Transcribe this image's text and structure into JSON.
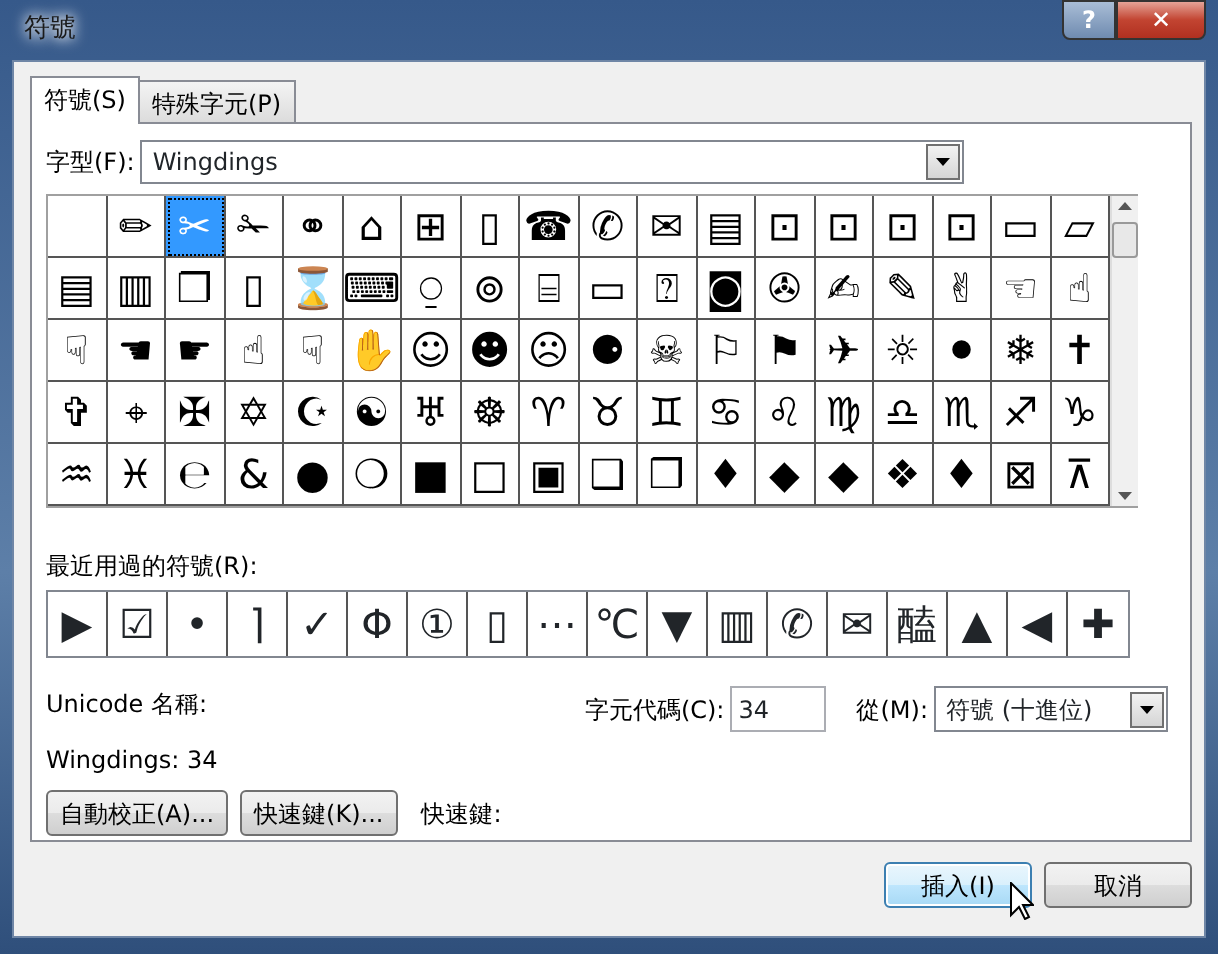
{
  "window": {
    "title": "符號",
    "help_button": "?",
    "close_button": "✕"
  },
  "tabs": [
    {
      "label": "符號(S)",
      "selected": true
    },
    {
      "label": "特殊字元(P)",
      "selected": false
    }
  ],
  "font": {
    "label": "字型(F):",
    "value": "Wingdings"
  },
  "grid": {
    "rows": [
      [
        {
          "selected": false
        },
        {
          "char": "✏",
          "selected": false
        },
        {
          "char": "✂",
          "selected": true
        },
        {
          "char": "✁",
          "selected": false
        },
        {
          "char": "⚭",
          "selected": false
        },
        {
          "char": "⌂",
          "selected": false
        },
        {
          "char": "⊞",
          "selected": false
        },
        {
          "char": "▯",
          "selected": false
        },
        {
          "char": "☎",
          "selected": false
        },
        {
          "char": "✆",
          "selected": false
        },
        {
          "char": "✉",
          "selected": false
        },
        {
          "char": "▤",
          "selected": false
        },
        {
          "char": "⊡",
          "selected": false
        },
        {
          "char": "⊡",
          "selected": false
        },
        {
          "char": "⊡",
          "selected": false
        },
        {
          "char": "⊡",
          "selected": false
        },
        {
          "char": "▭",
          "selected": false
        },
        {
          "char": "▱",
          "selected": false
        }
      ],
      [
        {
          "char": "▤",
          "selected": false
        },
        {
          "char": "▥",
          "selected": false
        },
        {
          "char": "❐",
          "selected": false
        },
        {
          "char": "▯",
          "selected": false
        },
        {
          "char": "⌛",
          "selected": false
        },
        {
          "char": "⌨",
          "selected": false
        },
        {
          "char": "⍜",
          "selected": false
        },
        {
          "char": "⊚",
          "selected": false
        },
        {
          "char": "⌸",
          "selected": false
        },
        {
          "char": "▭",
          "selected": false
        },
        {
          "char": "⍰",
          "selected": false
        },
        {
          "char": "◙",
          "selected": false
        },
        {
          "char": "✇",
          "selected": false
        },
        {
          "char": "✍",
          "selected": false
        },
        {
          "char": "✎",
          "selected": false
        },
        {
          "char": "✌",
          "selected": false
        },
        {
          "char": "☜",
          "selected": false
        },
        {
          "char": "☝",
          "selected": false
        }
      ],
      [
        {
          "char": "☟",
          "selected": false
        },
        {
          "char": "☚",
          "selected": false
        },
        {
          "char": "☛",
          "selected": false
        },
        {
          "char": "☝",
          "selected": false
        },
        {
          "char": "☟",
          "selected": false
        },
        {
          "char": "✋",
          "selected": false
        },
        {
          "char": "☺",
          "selected": false
        },
        {
          "char": "☻",
          "selected": false
        },
        {
          "char": "☹",
          "selected": false
        },
        {
          "char": "⚈",
          "selected": false
        },
        {
          "char": "☠",
          "selected": false
        },
        {
          "char": "⚐",
          "selected": false
        },
        {
          "char": "⚑",
          "selected": false
        },
        {
          "char": "✈",
          "selected": false
        },
        {
          "char": "☼",
          "selected": false
        },
        {
          "char": "⚫",
          "selected": false
        },
        {
          "char": "❄",
          "selected": false
        },
        {
          "char": "✝",
          "selected": false
        }
      ],
      [
        {
          "char": "✞",
          "selected": false
        },
        {
          "char": "⌖",
          "selected": false
        },
        {
          "char": "✠",
          "selected": false
        },
        {
          "char": "✡",
          "selected": false
        },
        {
          "char": "☪",
          "selected": false
        },
        {
          "char": "☯",
          "selected": false
        },
        {
          "char": "♅",
          "selected": false
        },
        {
          "char": "☸",
          "selected": false
        },
        {
          "char": "♈",
          "selected": false
        },
        {
          "char": "♉",
          "selected": false
        },
        {
          "char": "♊",
          "selected": false
        },
        {
          "char": "♋",
          "selected": false
        },
        {
          "char": "♌",
          "selected": false
        },
        {
          "char": "♍",
          "selected": false
        },
        {
          "char": "♎",
          "selected": false
        },
        {
          "char": "♏",
          "selected": false
        },
        {
          "char": "♐",
          "selected": false
        },
        {
          "char": "♑",
          "selected": false
        }
      ],
      [
        {
          "char": "♒",
          "selected": false
        },
        {
          "char": "♓",
          "selected": false
        },
        {
          "char": "℮",
          "selected": false
        },
        {
          "char": "&",
          "selected": false
        },
        {
          "char": "●",
          "selected": false
        },
        {
          "char": "❍",
          "selected": false
        },
        {
          "char": "■",
          "selected": false
        },
        {
          "char": "□",
          "selected": false
        },
        {
          "char": "▣",
          "selected": false
        },
        {
          "char": "❑",
          "selected": false
        },
        {
          "char": "❒",
          "selected": false
        },
        {
          "char": "♦",
          "selected": false
        },
        {
          "char": "◆",
          "selected": false
        },
        {
          "char": "◆",
          "selected": false
        },
        {
          "char": "❖",
          "selected": false
        },
        {
          "char": "♦",
          "selected": false
        },
        {
          "char": "⊠",
          "selected": false
        },
        {
          "char": "⊼",
          "selected": false
        }
      ]
    ]
  },
  "recent": {
    "label": "最近用過的符號(R):",
    "chars": [
      "▶",
      "☑",
      "•",
      "⌉",
      "✓",
      "Φ",
      "①",
      "▯",
      "⋯",
      "℃",
      "▼",
      "▥",
      "✆",
      "✉",
      "醘",
      "▲",
      "◀",
      "✚"
    ]
  },
  "unicode_name": {
    "label": "Unicode 名稱:"
  },
  "info": "Wingdings: 34",
  "char_code": {
    "label": "字元代碼(C):",
    "value": "34"
  },
  "from": {
    "label": "從(M):",
    "value": "符號 (十進位)"
  },
  "buttons": [
    {
      "label": "自動校正(A)..."
    },
    {
      "label": "快速鍵(K)..."
    }
  ],
  "shortcut_label": "快速鍵:",
  "dialog_buttons": [
    {
      "label": "插入(I)",
      "default": true
    },
    {
      "label": "取消",
      "default": false
    }
  ]
}
